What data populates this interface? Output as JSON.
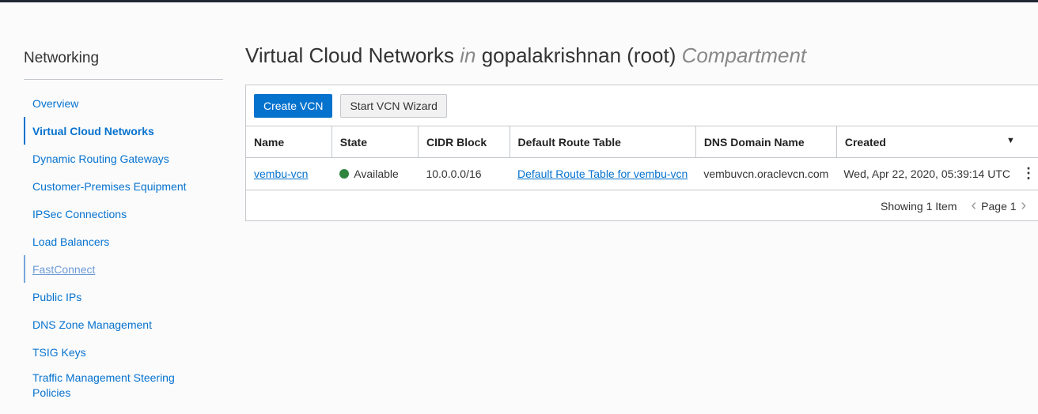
{
  "sidebar": {
    "title": "Networking",
    "items": [
      {
        "label": "Overview"
      },
      {
        "label": "Virtual Cloud Networks",
        "active": true
      },
      {
        "label": "Dynamic Routing Gateways"
      },
      {
        "label": "Customer-Premises Equipment"
      },
      {
        "label": "IPSec Connections"
      },
      {
        "label": "Load Balancers"
      },
      {
        "label": "FastConnect",
        "hover": true
      },
      {
        "label": "Public IPs"
      },
      {
        "label": "DNS Zone Management"
      },
      {
        "label": "TSIG Keys"
      },
      {
        "label": "Traffic Management Steering Policies"
      }
    ]
  },
  "header": {
    "title": "Virtual Cloud Networks",
    "in": "in",
    "compartment": "gopalakrishnan (root)",
    "suffix": "Compartment"
  },
  "toolbar": {
    "create": "Create VCN",
    "wizard": "Start VCN Wizard"
  },
  "table": {
    "columns": [
      "Name",
      "State",
      "CIDR Block",
      "Default Route Table",
      "DNS Domain Name",
      "Created"
    ],
    "rows": [
      {
        "name": "vembu-vcn",
        "state": "Available",
        "cidr": "10.0.0.0/16",
        "route": "Default Route Table for vembu-vcn",
        "dns": "vembuvcn.oraclevcn.com",
        "created": "Wed, Apr 22, 2020, 05:39:14 UTC"
      }
    ]
  },
  "footer": {
    "showing": "Showing 1 Item",
    "page": "Page 1"
  },
  "colors": {
    "accent": "#0572ce",
    "available": "#2e8540"
  }
}
